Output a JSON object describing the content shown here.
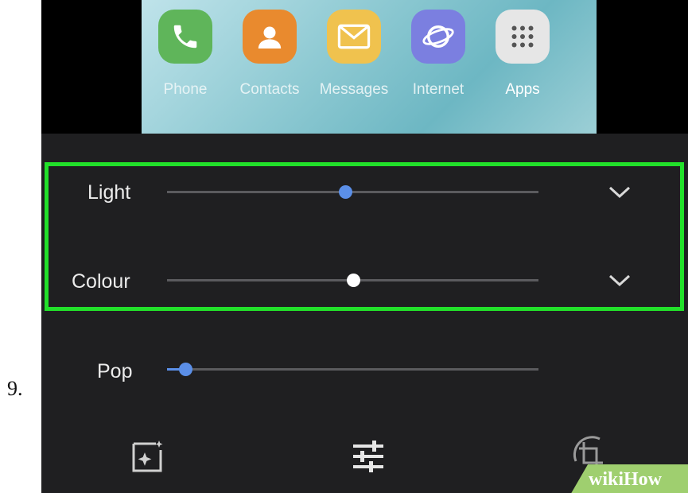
{
  "step": {
    "number": "9."
  },
  "dock": {
    "apps": [
      {
        "label": "Phone",
        "icon": "phone-icon",
        "color": "#5fb55a"
      },
      {
        "label": "Contacts",
        "icon": "contact-icon",
        "color": "#e98a2e"
      },
      {
        "label": "Messages",
        "icon": "envelope-icon",
        "color": "#f0c24e"
      },
      {
        "label": "Internet",
        "icon": "globe-icon",
        "color": "#7b7fe0"
      },
      {
        "label": "Apps",
        "icon": "grid-icon",
        "color": "#e6e6e6"
      }
    ]
  },
  "adjustments": {
    "light": {
      "label": "Light",
      "value": 0.48
    },
    "colour": {
      "label": "Colour",
      "value": 0.5
    },
    "pop": {
      "label": "Pop",
      "value": 0.05
    }
  },
  "toolbar": {
    "items": [
      {
        "icon": "auto-enhance-icon"
      },
      {
        "icon": "adjust-sliders-icon"
      },
      {
        "icon": "crop-rotate-icon"
      }
    ]
  },
  "watermark": {
    "text": "wikiHow"
  },
  "colors": {
    "highlight": "#22e02a",
    "accent": "#5b8fe8",
    "panel": "#1f1f21"
  }
}
